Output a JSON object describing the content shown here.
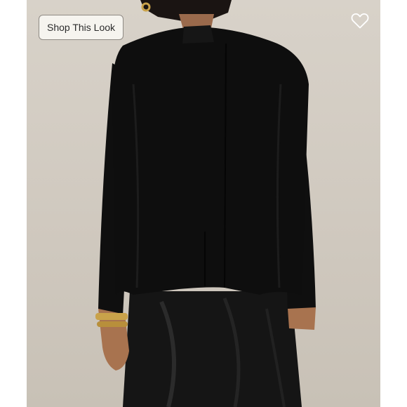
{
  "listing": {
    "shop_button_label": "Shop This Look",
    "like_icon": "heart-outline-icon"
  },
  "colors": {
    "backdrop": "#d6d0c7",
    "jacket": "#0e0e0e",
    "skin": "#b07a5a",
    "jewelry": "#c9a24a"
  }
}
